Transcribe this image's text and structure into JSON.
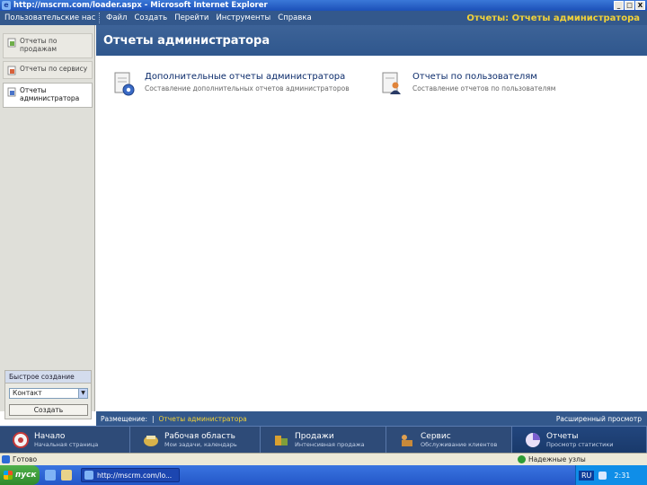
{
  "window": {
    "title": "http://mscrm.com/loader.aspx - Microsoft Internet Explorer",
    "buttons": [
      "_",
      "□",
      "X"
    ]
  },
  "appbar": {
    "user_menu": "Пользовательские настр",
    "menu": [
      "Файл",
      "Создать",
      "Перейти",
      "Инструменты",
      "Справка"
    ],
    "section_title": "Отчеты: Отчеты администратора"
  },
  "nav": {
    "items": [
      {
        "label": "Отчеты по продажам",
        "icon": "sales-report-icon"
      },
      {
        "label": "Отчеты по сервису",
        "icon": "service-report-icon"
      },
      {
        "label": "Отчеты администратора",
        "icon": "admin-report-icon"
      }
    ]
  },
  "quick_create": {
    "title": "Быстрое создание",
    "select_value": "Контакт",
    "button": "Создать"
  },
  "page": {
    "title": "Отчеты администратора",
    "reports": [
      {
        "title": "Дополнительные отчеты администратора",
        "description": "Составление дополнительных отчетов администраторов",
        "icon": "admin-reports-gear-icon"
      },
      {
        "title": "Отчеты по пользователям",
        "description": "Составление отчетов по пользователям",
        "icon": "user-reports-icon"
      }
    ]
  },
  "infobar": {
    "location_label": "Размещение:",
    "separator": "|",
    "crumb": "Отчеты администратора",
    "advanced": "Расширенный просмотр"
  },
  "modules": [
    {
      "name": "Начало",
      "sub": "Начальная страница",
      "icon": "home-icon",
      "color": "#c43a3a"
    },
    {
      "name": "Рабочая область",
      "sub": "Мои задачи, календарь",
      "icon": "workplace-icon",
      "color": "#d8b24a"
    },
    {
      "name": "Продажи",
      "sub": "Интенсивная продажа",
      "icon": "sales-icon",
      "color": "#d9a030"
    },
    {
      "name": "Сервис",
      "sub": "Обслуживание клиентов",
      "icon": "service-icon",
      "color": "#c98a3a"
    },
    {
      "name": "Отчеты",
      "sub": "Просмотр статистики",
      "icon": "reports-icon",
      "color": "#7a5fcf"
    }
  ],
  "statusbar": {
    "text": "Готово",
    "zone": "Надежные узлы"
  },
  "taskbar": {
    "start": "пуск",
    "task": "http://mscrm.com/lo...",
    "lang": "RU",
    "clock": "2:31"
  }
}
